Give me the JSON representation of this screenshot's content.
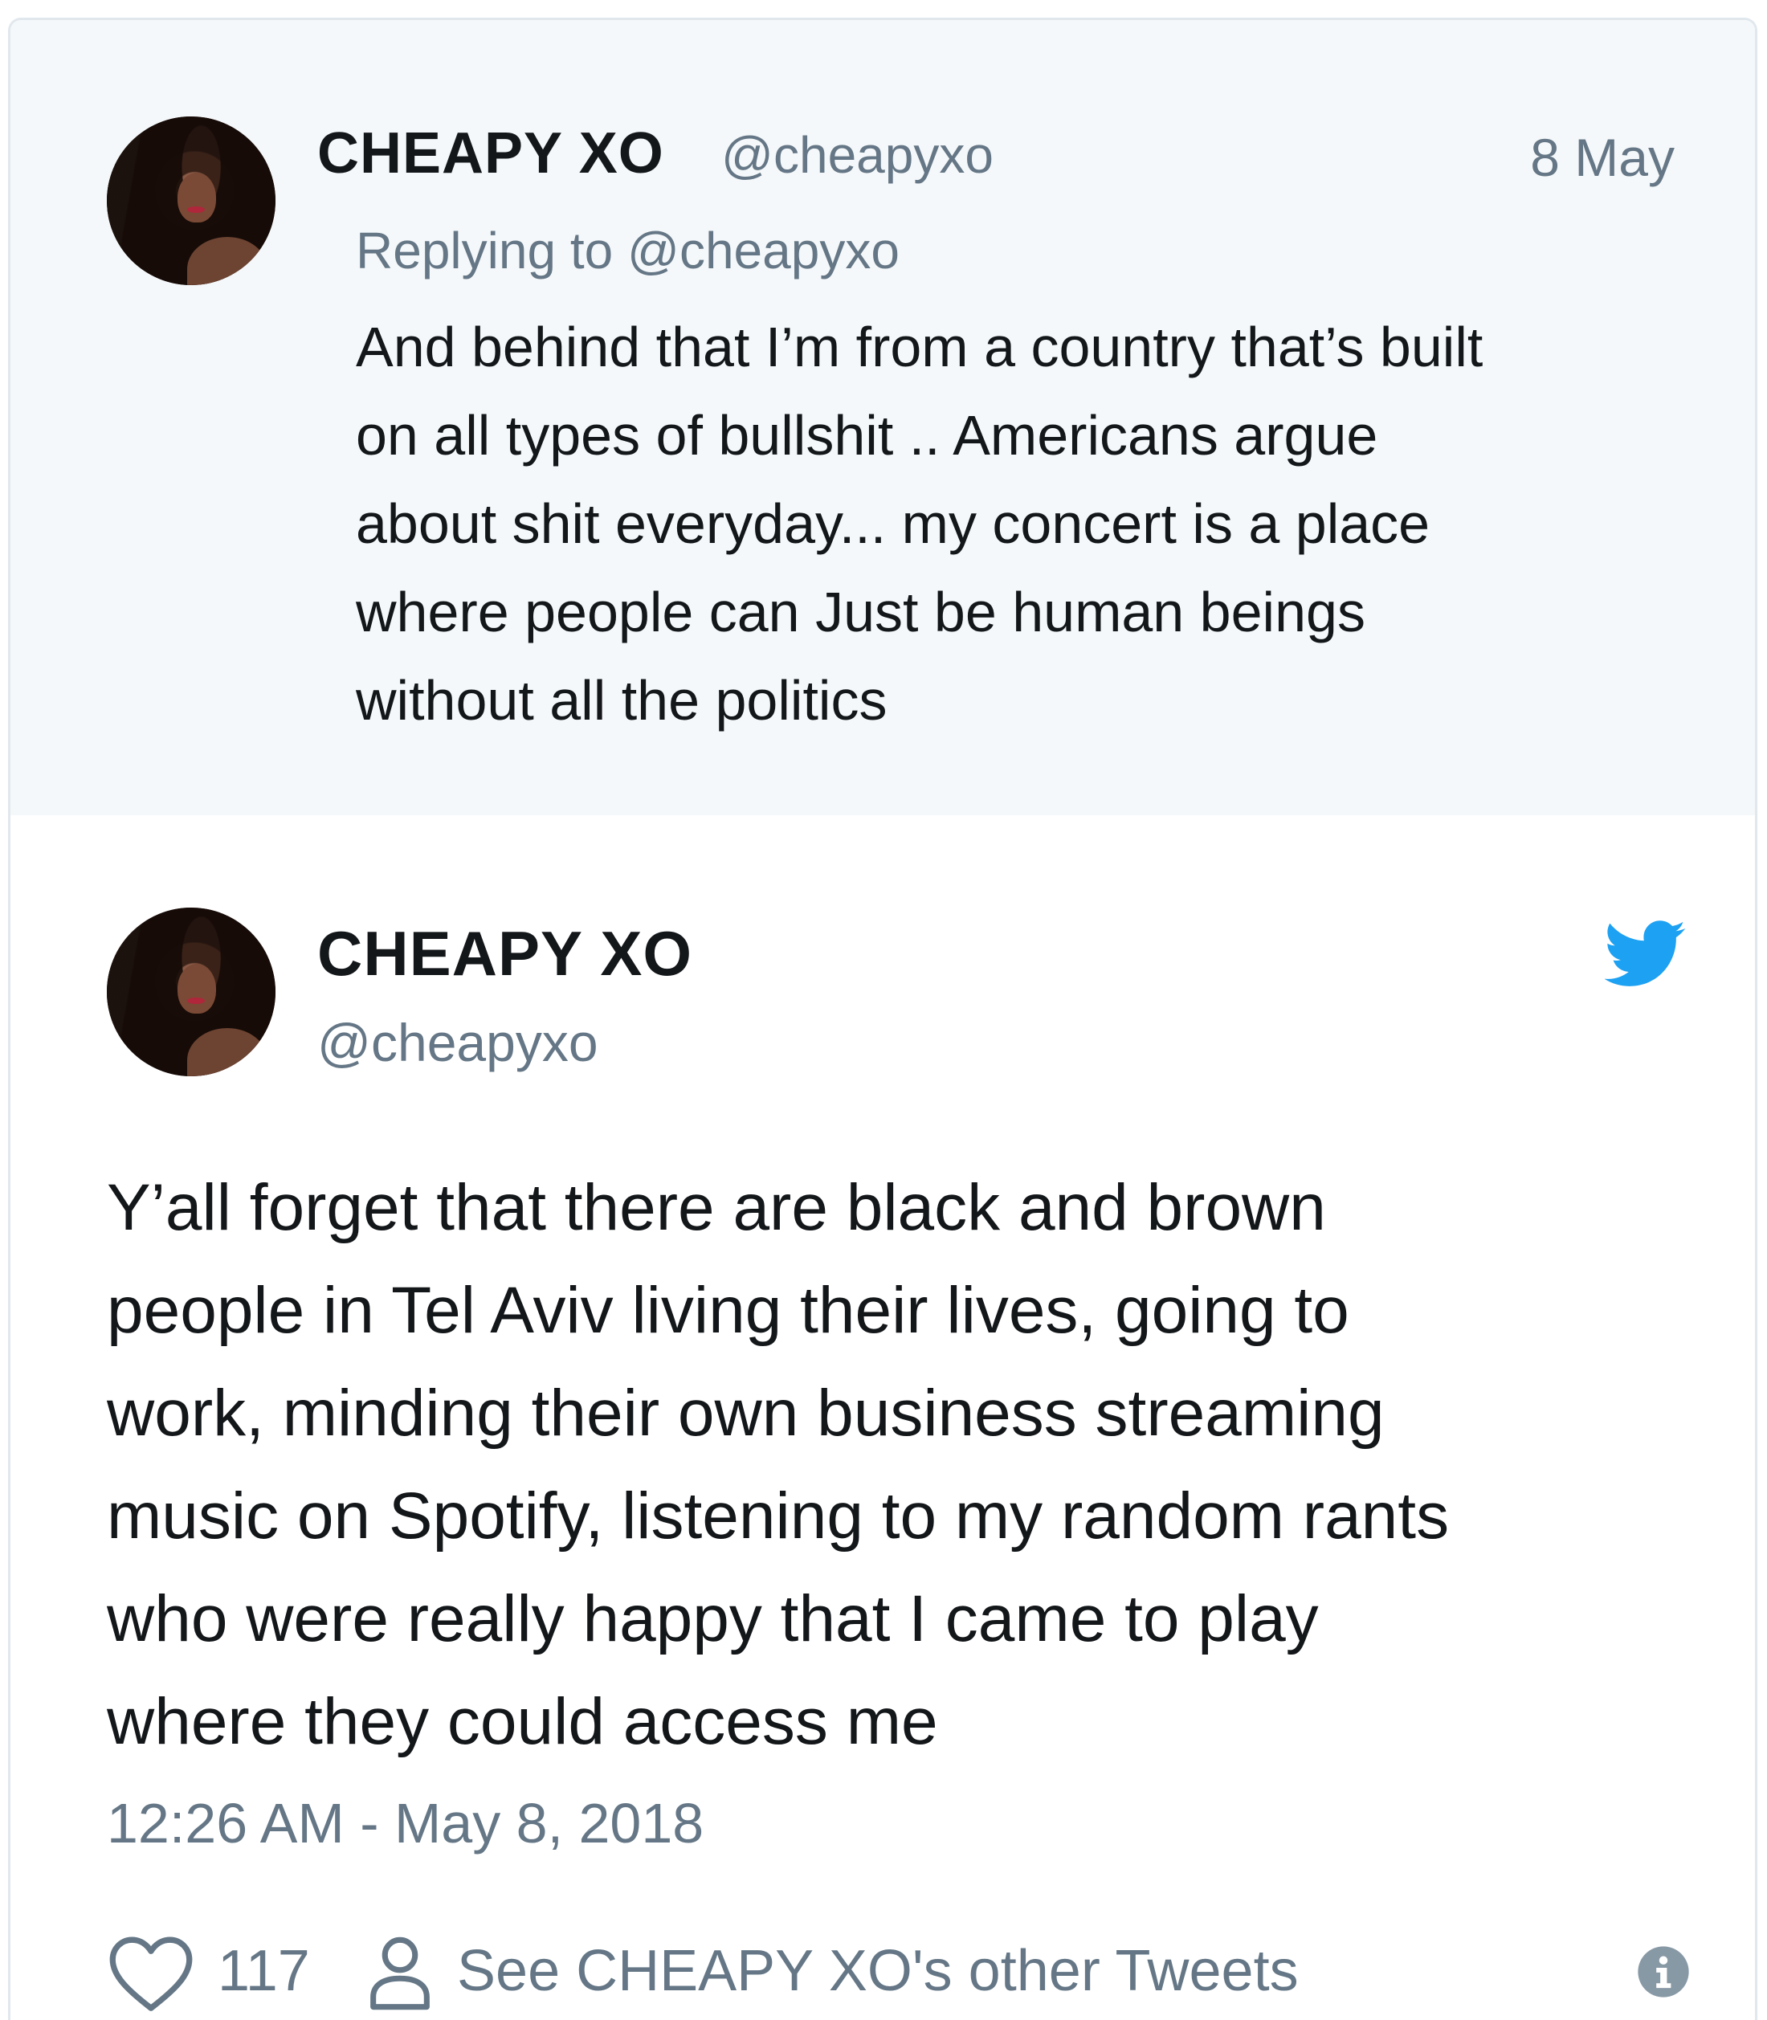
{
  "parent_tweet": {
    "name": "CHEAPY XO",
    "handle": "@cheapyxo",
    "date": "8 May",
    "replying_to": "Replying to @cheapyxo",
    "text_lines": [
      "And behind that I’m from a country that’s built",
      "on all types of bullshit .. Americans argue",
      "about shit everyday... my concert is a place",
      "where people can Just be human beings",
      "without all the politics"
    ]
  },
  "main_tweet": {
    "name": "CHEAPY XO",
    "handle": "@cheapyxo",
    "text_lines": [
      "Y’all forget that there are black and brown",
      "people in Tel Aviv living their lives, going to",
      "work, minding their own business streaming",
      "music on Spotify, listening to my random rants",
      "who were really happy that I came to play",
      "where they could access me"
    ],
    "timestamp": "12:26 AM - May 8, 2018",
    "like_count": "117",
    "other_tweets_label": "See CHEAPY XO's other Tweets"
  },
  "icons": {
    "brand": "twitter-bird-icon",
    "like": "heart-icon",
    "profile": "person-icon",
    "info": "info-icon"
  },
  "colors": {
    "text_primary": "#14171a",
    "text_secondary": "#657786",
    "twitter_blue": "#1da1f2",
    "parent_background": "#f5f8fa",
    "border": "#e1e8ed"
  }
}
